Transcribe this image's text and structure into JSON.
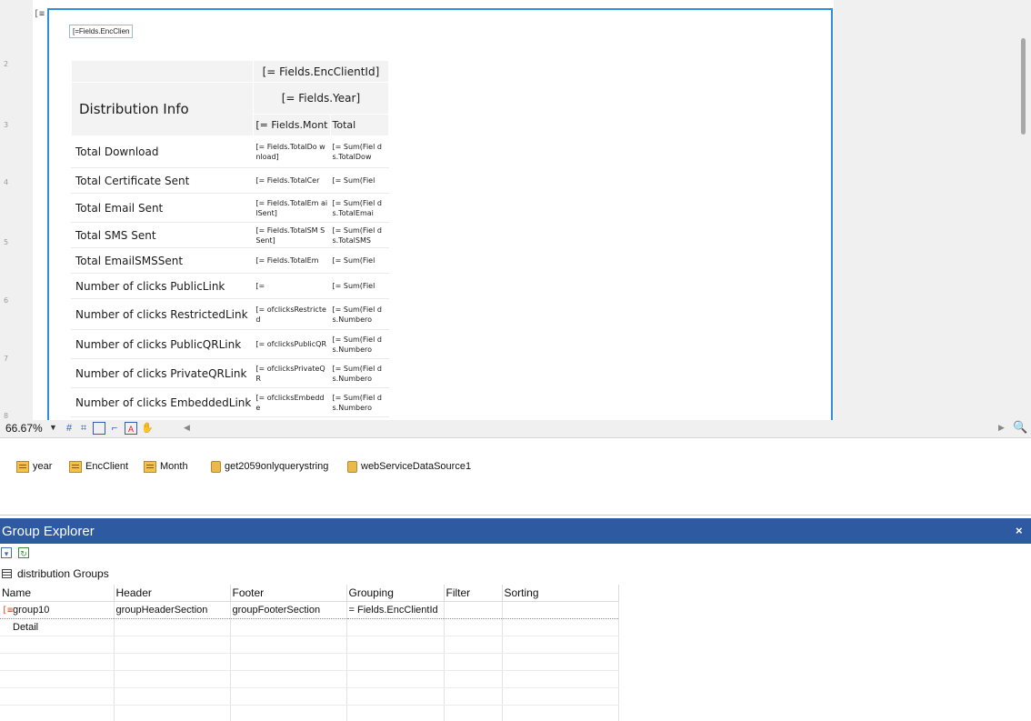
{
  "designer": {
    "group_marker": "[≡",
    "top_field": "[=Fields.EncClien",
    "ruler_ticks": [
      "2",
      "3",
      "4",
      "5",
      "6",
      "7",
      "8"
    ],
    "pivot": {
      "col_header_1": "[= Fields.EncClientId]",
      "col_header_2": "[= Fields.Year]",
      "col_header_3a": "[= Fields.Mont",
      "col_header_3b": "Total",
      "title": "Distribution Info",
      "rows": [
        {
          "label": "Total Download",
          "c1": "[= Fields.TotalDo wnload]",
          "c2": "[= Sum(Fiel ds.TotalDow"
        },
        {
          "label": "Total Certificate Sent",
          "c1": "[= Fields.TotalCer",
          "c2": "[= Sum(Fiel"
        },
        {
          "label": "Total Email Sent",
          "c1": "[= Fields.TotalEm ailSent]",
          "c2": "[= Sum(Fiel ds.TotalEmai"
        },
        {
          "label": "Total SMS Sent",
          "c1": "[= Fields.TotalSM SSent]",
          "c2": "[= Sum(Fiel ds.TotalSMS"
        },
        {
          "label": "Total EmailSMSSent",
          "c1": "[= Fields.TotalEm",
          "c2": "[= Sum(Fiel"
        },
        {
          "label": "Number of clicks PublicLink",
          "c1": "[=",
          "c2": "[= Sum(Fiel"
        },
        {
          "label": "Number of clicks RestrictedLink",
          "c1": "[= ofclicksRestricted",
          "c2": "[= Sum(Fiel ds.Numbero"
        },
        {
          "label": "Number of clicks PublicQRLink",
          "c1": "[= ofclicksPublicQR",
          "c2": "[= Sum(Fiel ds.Numbero"
        },
        {
          "label": "Number of clicks PrivateQRLink",
          "c1": "[= ofclicksPrivateQR",
          "c2": "[= Sum(Fiel ds.Numbero"
        },
        {
          "label": "Number of clicks EmbeddedLink",
          "c1": "[= ofclicksEmbedde",
          "c2": "[= Sum(Fiel ds.Numbero"
        }
      ]
    }
  },
  "zoom": {
    "value": "66.67%",
    "tools": [
      "grid-icon",
      "snap-grid-icon",
      "snap-lines-icon",
      "dimensions-icon",
      "text-icon",
      "pan-hand-icon"
    ]
  },
  "tray": {
    "items": [
      {
        "label": "year",
        "icon": "csv-datasource-icon"
      },
      {
        "label": "EncClient",
        "icon": "csv-datasource-icon"
      },
      {
        "label": "Month",
        "icon": "csv-datasource-icon"
      },
      {
        "label": "get2059onlyquerystring",
        "icon": "database-icon"
      },
      {
        "label": "webServiceDataSource1",
        "icon": "database-icon"
      }
    ]
  },
  "group_explorer": {
    "title": "Group Explorer",
    "close_glyph": "×",
    "groups_label": "distribution Groups",
    "columns": [
      "Name",
      "Header",
      "Footer",
      "Grouping",
      "Filter",
      "Sorting"
    ],
    "rows": [
      {
        "marker": "[≡",
        "name": "group10",
        "header": "groupHeaderSection",
        "footer": "groupFooterSection",
        "grouping": "= Fields.EncClientId",
        "filter": "",
        "sorting": ""
      },
      {
        "marker": "",
        "name": "Detail",
        "header": "",
        "footer": "",
        "grouping": "",
        "filter": "",
        "sorting": ""
      }
    ],
    "empty_rows": 5
  },
  "colors": {
    "accent": "#2d5aa0",
    "page_border": "#2b8fdb"
  }
}
